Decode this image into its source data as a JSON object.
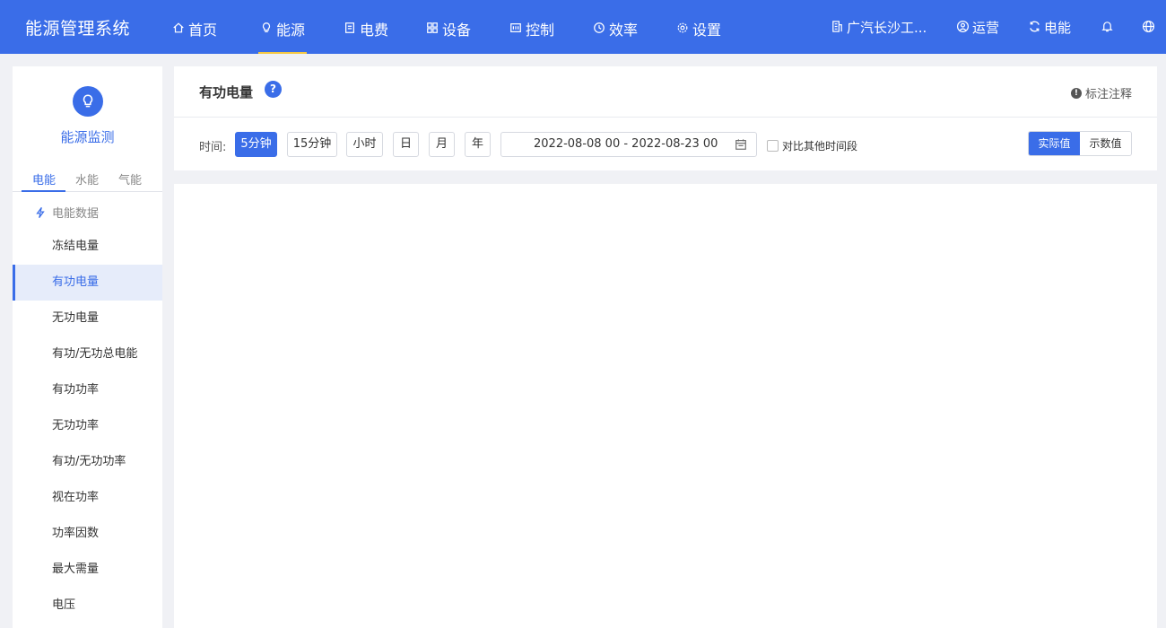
{
  "app": {
    "title": "能源管理系统"
  },
  "nav": [
    {
      "label": "首页",
      "icon": "home-icon"
    },
    {
      "label": "能源",
      "icon": "bulb-icon",
      "active": true
    },
    {
      "label": "电费",
      "icon": "bill-icon"
    },
    {
      "label": "设备",
      "icon": "grid-icon"
    },
    {
      "label": "控制",
      "icon": "control-icon"
    },
    {
      "label": "效率",
      "icon": "clock-icon"
    },
    {
      "label": "设置",
      "icon": "gear-icon"
    }
  ],
  "right_nav": {
    "site": "广汽长沙工...",
    "ops": "运营",
    "energy": "电能"
  },
  "sidebar": {
    "title": "能源监测",
    "tabs": [
      {
        "label": "电能",
        "active": true
      },
      {
        "label": "水能"
      },
      {
        "label": "气能"
      }
    ],
    "section": "电能数据",
    "items": [
      {
        "label": "冻结电量"
      },
      {
        "label": "有功电量",
        "active": true
      },
      {
        "label": "无功电量"
      },
      {
        "label": "有功/无功总电能"
      },
      {
        "label": "有功功率"
      },
      {
        "label": "无功功率"
      },
      {
        "label": "有功/无功功率"
      },
      {
        "label": "视在功率"
      },
      {
        "label": "功率因数"
      },
      {
        "label": "最大需量"
      },
      {
        "label": "电压"
      }
    ]
  },
  "panel": {
    "title": "有功电量",
    "help": "?",
    "annotation": "标注注释",
    "time_label": "时间:",
    "time_buttons": [
      {
        "label": "5分钟",
        "active": true
      },
      {
        "label": "15分钟"
      },
      {
        "label": "小时"
      },
      {
        "label": "日"
      },
      {
        "label": "月"
      },
      {
        "label": "年"
      }
    ],
    "date_range": "2022-08-08 00 - 2022-08-23 00",
    "compare_label": "对比其他时间段",
    "value_mode": [
      {
        "label": "实际值",
        "active": true
      },
      {
        "label": "示数值"
      }
    ]
  },
  "colors": {
    "primary": "#3a6de8",
    "accent": "#f5c842",
    "background": "#f0f1f5"
  }
}
